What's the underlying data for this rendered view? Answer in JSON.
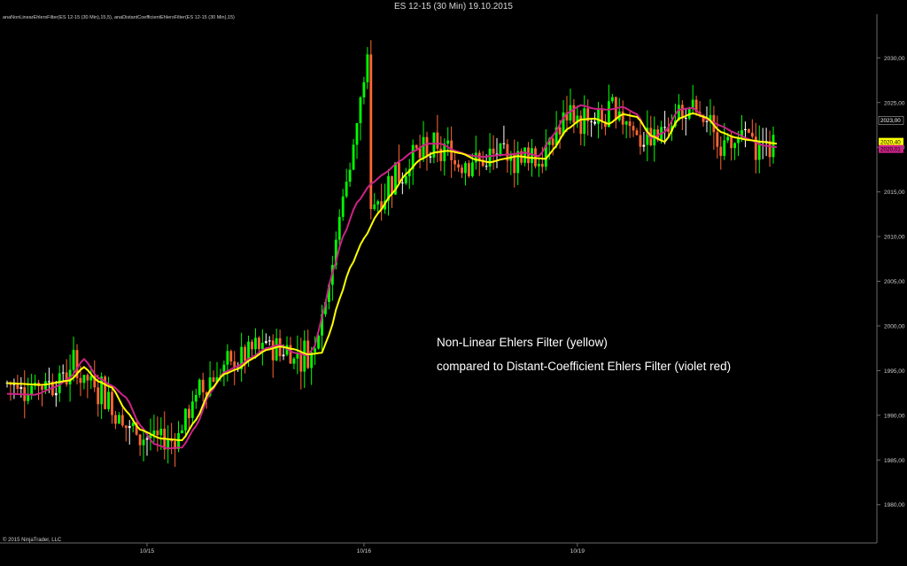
{
  "window": {
    "title": "ES 12-15 (30 Min)  19.10.2015",
    "indicator_label": "anaNonLinearEhlersFilter(ES 12-15 (30 Min),15,5), anaDistantCoefficientEhlersFilter(ES 12-15 (30 Min),15)",
    "copyright": "© 2015 NinjaTrader, LLC"
  },
  "annotations": {
    "line1": "Non-Linear Ehlers Filter (yellow)",
    "line2": "compared to Distant-Coefficient Ehlers Filter (violet red)"
  },
  "colors": {
    "background": "#000000",
    "up_candle": "#00ff00",
    "down_candle": "#ff6633",
    "doji_candle": "#ffffff",
    "nonlinear_filter": "#ffff00",
    "distant_coefficient_filter": "#cc2288",
    "axis": "#6a6a6a",
    "price_tag_nonlinear": "#ffff00",
    "price_tag_distant": "#cc2288",
    "price_tag_last": "#ffffff"
  },
  "chart_data": {
    "type": "candlestick",
    "instrument": "ES 12-15",
    "interval": "30 Min",
    "y_ticks": [
      "1980,00",
      "1985,00",
      "1990,00",
      "1995,00",
      "2000,00",
      "2005,00",
      "2010,00",
      "2015,00",
      "2020,00",
      "2025,00",
      "2030,00"
    ],
    "ylim": [
      1977.0,
      2033.5
    ],
    "x_ticks": [
      {
        "label": "10/15",
        "bar": 40
      },
      {
        "label": "10/16",
        "bar": 102
      },
      {
        "label": "10/19",
        "bar": 163
      }
    ],
    "n_bars": 220,
    "last_price_tags": [
      {
        "label": "2023,00",
        "value": 2023.0,
        "series": "last"
      },
      {
        "label": "2020,40",
        "value": 2020.4,
        "series": "nonlinear"
      },
      {
        "label": "2020,01",
        "value": 2020.0,
        "series": "distant"
      }
    ],
    "nonlinear_anchors": [
      [
        0,
        1993.6
      ],
      [
        10,
        1993.4
      ],
      [
        18,
        1993.9
      ],
      [
        22,
        1995.4
      ],
      [
        26,
        1993.8
      ],
      [
        30,
        1993.1
      ],
      [
        34,
        1990.5
      ],
      [
        38,
        1988.4
      ],
      [
        44,
        1987.4
      ],
      [
        50,
        1987.2
      ],
      [
        54,
        1989.5
      ],
      [
        58,
        1992.8
      ],
      [
        62,
        1994.6
      ],
      [
        66,
        1995.2
      ],
      [
        70,
        1996.3
      ],
      [
        74,
        1997.3
      ],
      [
        78,
        1997.7
      ],
      [
        82,
        1997.4
      ],
      [
        86,
        1996.8
      ],
      [
        90,
        1997.0
      ],
      [
        92,
        1999.0
      ],
      [
        95,
        2003.0
      ],
      [
        98,
        2006.5
      ],
      [
        102,
        2009.8
      ],
      [
        106,
        2012.6
      ],
      [
        110,
        2014.8
      ],
      [
        114,
        2017.0
      ],
      [
        118,
        2018.6
      ],
      [
        122,
        2019.4
      ],
      [
        126,
        2019.6
      ],
      [
        130,
        2019.3
      ],
      [
        134,
        2018.6
      ],
      [
        138,
        2018.3
      ],
      [
        142,
        2018.7
      ],
      [
        146,
        2019.0
      ],
      [
        150,
        2018.8
      ],
      [
        154,
        2018.7
      ],
      [
        156,
        2019.7
      ],
      [
        160,
        2022.0
      ],
      [
        164,
        2023.1
      ],
      [
        168,
        2023.2
      ],
      [
        172,
        2022.6
      ],
      [
        176,
        2023.7
      ],
      [
        180,
        2023.4
      ],
      [
        184,
        2021.3
      ],
      [
        188,
        2020.6
      ],
      [
        192,
        2023.2
      ],
      [
        196,
        2023.8
      ],
      [
        200,
        2023.3
      ],
      [
        204,
        2021.7
      ],
      [
        208,
        2021.1
      ],
      [
        212,
        2020.8
      ],
      [
        216,
        2020.6
      ],
      [
        220,
        2020.4
      ]
    ],
    "distant_anchors": [
      [
        0,
        1992.4
      ],
      [
        8,
        1992.3
      ],
      [
        14,
        1993.2
      ],
      [
        18,
        1994.2
      ],
      [
        22,
        1996.3
      ],
      [
        26,
        1994.2
      ],
      [
        30,
        1993.3
      ],
      [
        34,
        1992.0
      ],
      [
        38,
        1988.9
      ],
      [
        42,
        1986.8
      ],
      [
        46,
        1986.3
      ],
      [
        50,
        1986.4
      ],
      [
        54,
        1988.8
      ],
      [
        58,
        1992.5
      ],
      [
        62,
        1994.8
      ],
      [
        66,
        1995.5
      ],
      [
        70,
        1996.5
      ],
      [
        74,
        1997.5
      ],
      [
        78,
        1997.9
      ],
      [
        82,
        1997.0
      ],
      [
        86,
        1996.7
      ],
      [
        88,
        1997.8
      ],
      [
        90,
        2001.0
      ],
      [
        93,
        2006.0
      ],
      [
        96,
        2010.0
      ],
      [
        100,
        2013.8
      ],
      [
        104,
        2015.9
      ],
      [
        108,
        2017.1
      ],
      [
        112,
        2018.4
      ],
      [
        116,
        2019.5
      ],
      [
        120,
        2020.4
      ],
      [
        124,
        2020.4
      ],
      [
        128,
        2019.6
      ],
      [
        132,
        2019.1
      ],
      [
        136,
        2018.9
      ],
      [
        140,
        2019.1
      ],
      [
        144,
        2019.2
      ],
      [
        148,
        2019.4
      ],
      [
        152,
        2019.0
      ],
      [
        156,
        2021.3
      ],
      [
        160,
        2023.8
      ],
      [
        164,
        2024.7
      ],
      [
        168,
        2024.3
      ],
      [
        172,
        2024.2
      ],
      [
        176,
        2024.5
      ],
      [
        180,
        2023.7
      ],
      [
        184,
        2021.0
      ],
      [
        188,
        2021.7
      ],
      [
        192,
        2024.2
      ],
      [
        196,
        2024.4
      ],
      [
        200,
        2023.1
      ],
      [
        204,
        2022.4
      ],
      [
        208,
        2021.6
      ],
      [
        212,
        2020.9
      ],
      [
        216,
        2020.2
      ],
      [
        220,
        2020.0
      ]
    ]
  }
}
